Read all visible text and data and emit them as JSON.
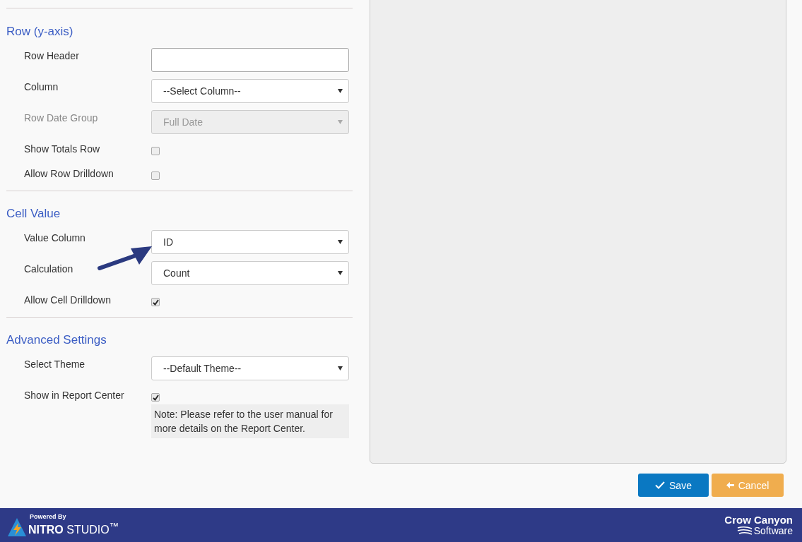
{
  "sections": [
    {
      "title": "Row (y-axis)",
      "fields": [
        {
          "label": "Row Header",
          "kind": "text",
          "disabled": false
        },
        {
          "label": "Column",
          "kind": "select",
          "value": "--Select Column--",
          "disabled": false
        },
        {
          "label": "Row Date Group",
          "kind": "select",
          "value": "Full Date",
          "disabled": true
        },
        {
          "label": "Show Totals Row",
          "kind": "checkbox",
          "checked": false
        },
        {
          "label": "Allow Row Drilldown",
          "kind": "checkbox",
          "checked": false
        }
      ]
    },
    {
      "title": "Cell Value",
      "fields": [
        {
          "label": "Value Column",
          "kind": "select",
          "value": "ID",
          "disabled": false
        },
        {
          "label": "Calculation",
          "kind": "select",
          "value": "Count",
          "disabled": false
        },
        {
          "label": "Allow Cell Drilldown",
          "kind": "checkbox",
          "checked": true
        }
      ]
    },
    {
      "title": "Advanced Settings",
      "fields": [
        {
          "label": "Select Theme",
          "kind": "select",
          "value": "--Default Theme--",
          "disabled": false
        },
        {
          "label": "Show in Report Center",
          "kind": "checkbox",
          "checked": true,
          "note": "Note: Please refer to the user manual for more details on the Report Center."
        }
      ]
    }
  ],
  "buttons": [
    {
      "label": "Save",
      "kind": "save"
    },
    {
      "label": "Cancel",
      "kind": "cancel"
    }
  ],
  "footer": {
    "powered_by": "Powered By",
    "product": "**NITRO** STUDIO$^{™}$",
    "company": "Crow Canyon",
    "company_sub": "Software"
  }
}
